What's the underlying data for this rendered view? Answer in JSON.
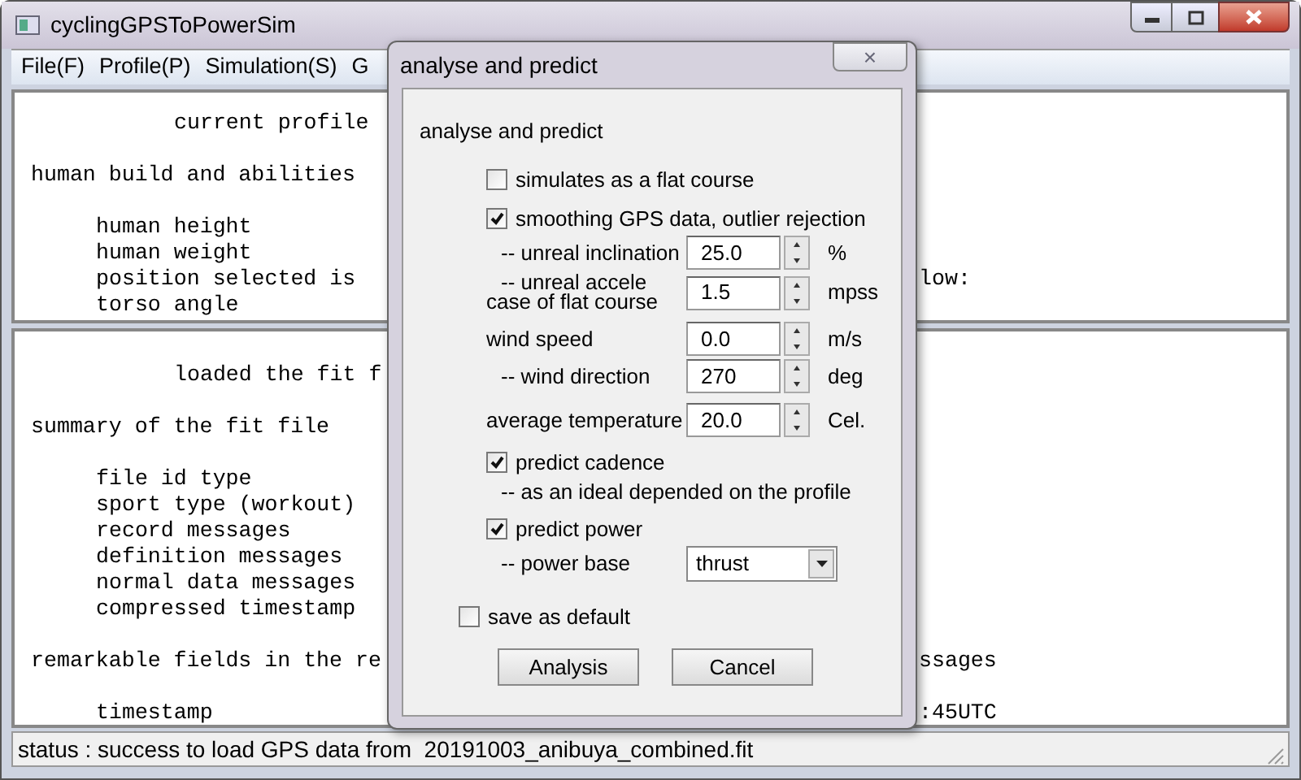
{
  "window": {
    "title": "cyclingGPSToPowerSim"
  },
  "menu": [
    "File(F)",
    "Profile(P)",
    "Simulation(S)",
    "G"
  ],
  "top_pane": {
    "blocks": [
      [
        {
          "kind": "title",
          "text": "current profile"
        }
      ],
      [
        {
          "kind": "heading",
          "text": "human build and abilities"
        }
      ],
      [
        {
          "kind": "item",
          "text": "human height"
        },
        {
          "kind": "item",
          "text": "human weight"
        },
        {
          "kind": "item",
          "text": "position selected is",
          "right": "low:"
        },
        {
          "kind": "item",
          "text": "torso angle"
        }
      ]
    ]
  },
  "bottom_pane": {
    "blocks": [
      [
        {
          "kind": "title",
          "text": "loaded the fit f"
        }
      ],
      [
        {
          "kind": "heading",
          "text": "summary of the fit file"
        }
      ],
      [
        {
          "kind": "item",
          "text": "file id type"
        },
        {
          "kind": "item",
          "text": "sport type (workout)"
        },
        {
          "kind": "item",
          "text": "record messages"
        },
        {
          "kind": "item",
          "text": "definition messages"
        },
        {
          "kind": "item",
          "text": "normal data messages"
        },
        {
          "kind": "item",
          "text": "compressed timestamp"
        }
      ],
      [
        {
          "kind": "heading",
          "text": "remarkable fields in the re",
          "right": "ssages"
        }
      ],
      [
        {
          "kind": "item",
          "text": "timestamp",
          "right": ":45UTC"
        }
      ]
    ]
  },
  "status_bar": "status : success to load GPS data from  20191003_anibuya_combined.fit",
  "dialog": {
    "title": "analyse and predict",
    "close": "×",
    "heading": "analyse and predict",
    "options": [
      {
        "kind": "checkbox",
        "label": "simulates as a flat course",
        "checked": false
      },
      {
        "kind": "checkbox",
        "label": "smoothing GPS data, outlier rejection",
        "checked": true,
        "children": [
          {
            "kind": "spin",
            "label_lines": [
              "-- unreal inclination"
            ],
            "value": "25.0",
            "unit": "%"
          },
          {
            "kind": "spin",
            "label_lines": [
              "-- unreal accele",
              "case of flat course"
            ],
            "value": "1.5",
            "unit": "mpss"
          }
        ]
      },
      {
        "kind": "spin",
        "label_lines": [
          "wind speed"
        ],
        "value": "0.0",
        "unit": "m/s",
        "children": [
          {
            "kind": "spin",
            "label_lines": [
              "-- wind direction"
            ],
            "value": "270",
            "unit": "deg"
          }
        ]
      },
      {
        "kind": "spin",
        "label_lines": [
          "average temperature"
        ],
        "value": "20.0",
        "unit": "Cel."
      },
      {
        "kind": "checkbox",
        "label": "predict cadence",
        "checked": true,
        "children": [
          {
            "kind": "note",
            "label": "-- as an ideal depended on the profile"
          }
        ]
      },
      {
        "kind": "checkbox",
        "label": "predict power",
        "checked": true,
        "children": [
          {
            "kind": "select",
            "label_lines": [
              "-- power base"
            ],
            "value": "thrust"
          }
        ]
      }
    ],
    "save_default": {
      "label": "save as default",
      "checked": false
    },
    "buttons": [
      "Analysis",
      "Cancel"
    ]
  }
}
